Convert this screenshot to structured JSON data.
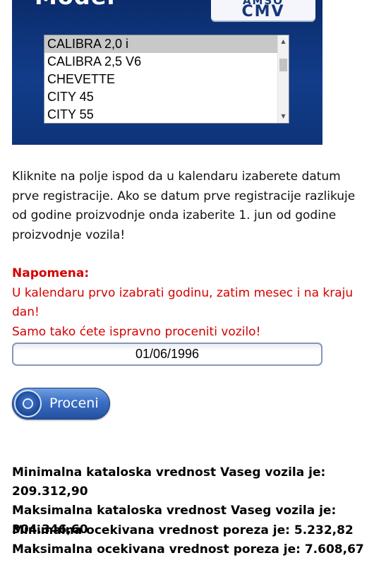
{
  "header": {
    "title": "Model",
    "logo_top": "AMSO",
    "logo_bottom": "CMV"
  },
  "model_list": {
    "selected": "CALIBRA 2,0 i",
    "items": [
      "CALIBRA 2,0 i",
      "CALIBRA 2,5 V6",
      "CHEVETTE",
      "CITY 45",
      "CITY 55"
    ]
  },
  "instructions": {
    "line1": "Kliknite na polje ispod da u kalendaru izaberete datum",
    "line2": "prve registracije. Ako se datum prve registracije razlikuje",
    "line3": "od godine proizvodnje onda izaberite 1. jun od godine",
    "line4": "proizvodnje vozila!"
  },
  "note": {
    "title": "Napomena:",
    "line1": "U kalendaru prvo izabrati godinu, zatim mesec i na kraju dan!",
    "line2": "Samo tako ćete ispravno proceniti vozilo!"
  },
  "date_field": {
    "value": "01/06/1996"
  },
  "estimate_button": {
    "label": "Proceni",
    "icon": "circle-icon"
  },
  "results": {
    "min_catalog": "Minimalna kataloska vrednost Vaseg vozila je: 209.312,90",
    "max_catalog": "Maksimalna kataloska vrednost Vaseg vozila je: 304.346,60",
    "min_tax": "Minimalna ocekivana vrednost poreza je: 5.232,82",
    "max_tax": "Maksimalna ocekivana vrednost poreza je: 7.608,67"
  },
  "colors": {
    "panel": "#123d8a",
    "note_text": "#d40000",
    "button": "#3b6fc6"
  }
}
